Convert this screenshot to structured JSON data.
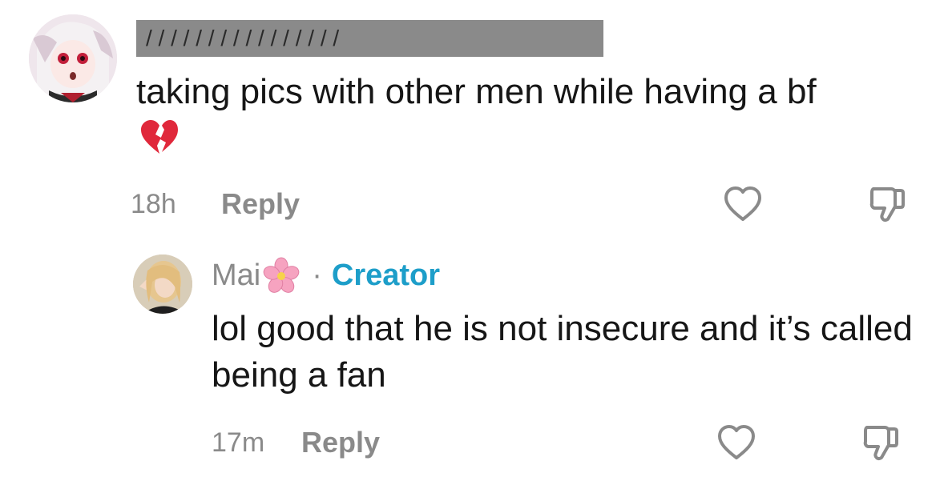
{
  "comments": [
    {
      "username_redacted": "/ / / / / / / / / / / / / / / /",
      "text": "taking pics with other men while having a bf",
      "emoji": "broken-heart",
      "time": "18h",
      "reply_label": "Reply",
      "like_icon": "heart-outline-icon",
      "dislike_icon": "thumbs-down-outline-icon"
    },
    {
      "username": "Mai",
      "name_emoji": "cherry-blossom",
      "separator": "·",
      "badge": "Creator",
      "text": "lol good that he is not insecure and it’s called being a fan",
      "time": "17m",
      "reply_label": "Reply",
      "like_icon": "heart-outline-icon",
      "dislike_icon": "thumbs-down-outline-icon"
    }
  ],
  "colors": {
    "text": "#161616",
    "muted": "#8a8a8a",
    "creator_badge": "#1d9ec9",
    "broken_heart": "#e0283b",
    "flower": "#f6a3c0"
  }
}
